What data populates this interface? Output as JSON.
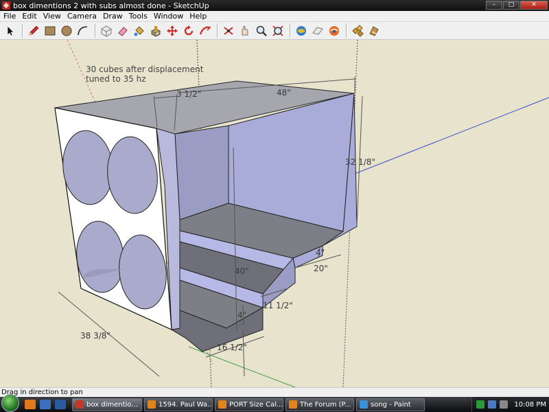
{
  "window": {
    "title": "box dimentions 2 with subs almost done - SketchUp",
    "minimize": "–",
    "maximize": "□",
    "close": "✕"
  },
  "menu": [
    "File",
    "Edit",
    "View",
    "Camera",
    "Draw",
    "Tools",
    "Window",
    "Help"
  ],
  "toolbar": {
    "groups": [
      [
        "select-tool-icon"
      ],
      [
        "pencil-tool-icon",
        "rectangle-tool-icon",
        "circle-tool-icon",
        "arc-tool-icon"
      ],
      [
        "make-component-icon",
        "eraser-tool-icon",
        "paint-bucket-icon",
        "push-pull-icon",
        "move-tool-icon",
        "rotate-tool-icon",
        "follow-me-icon"
      ],
      [
        "offset-tool-icon",
        "orbit-tool-icon",
        "pan-tool-icon",
        "zoom-tool-icon",
        "zoom-extents-icon"
      ],
      [
        "get-models-icon",
        "share-model-icon",
        "google-earth-icon"
      ],
      [
        "components-icon",
        "materials-icon"
      ]
    ]
  },
  "canvas": {
    "note_line1": "30 cubes after displacement",
    "note_line2": "tuned to 35 hz",
    "dimensions": {
      "d1": "3 1/2\"",
      "d2": "48\"",
      "d3": "32 1/8\"",
      "d4": "40\"",
      "d5": "4\"",
      "d6": "20\"",
      "d7": "11 1/2\"",
      "d8": "4\"",
      "d9": "38 3/8\"",
      "d10": "16 1/2\""
    }
  },
  "status": {
    "text": "Drag in direction to pan"
  },
  "taskbar": {
    "tasks": [
      {
        "label": "box dimentio...",
        "color": "#c23a2c",
        "active": true
      },
      {
        "label": "1594. Paul Wa...",
        "color": "#e2841e",
        "active": false
      },
      {
        "label": "PORT Size Cal...",
        "color": "#e2841e",
        "active": false
      },
      {
        "label": "The Forum (P...",
        "color": "#e2841e",
        "active": false
      },
      {
        "label": "song - Paint",
        "color": "#3b8fd6",
        "active": false
      }
    ],
    "clock": "10:08 PM"
  }
}
